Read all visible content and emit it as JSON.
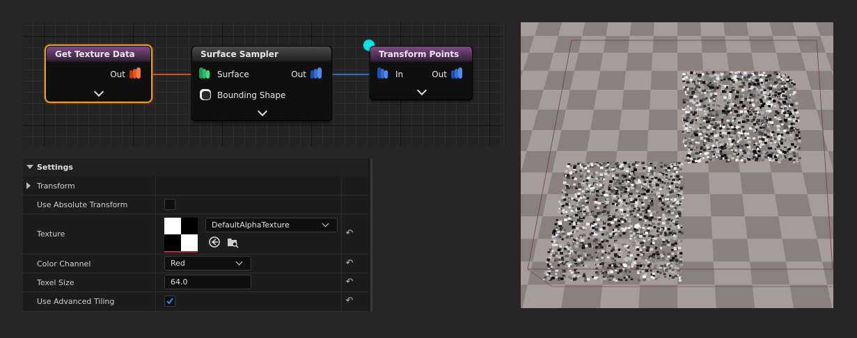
{
  "graph": {
    "nodes": {
      "get_texture_data": {
        "title": "Get Texture Data",
        "out_label": "Out"
      },
      "surface_sampler": {
        "title": "Surface Sampler",
        "surface_label": "Surface",
        "bounding_label": "Bounding Shape",
        "out_label": "Out"
      },
      "transform_points": {
        "title": "Transform Points",
        "in_label": "In",
        "out_label": "Out"
      }
    },
    "colors": {
      "orange_wire": "#d9531e",
      "blue_wire": "#2f6fd6",
      "selection": "#f39c12",
      "reroute_dot": "#00e5e5"
    }
  },
  "settings": {
    "section_title": "Settings",
    "rows": {
      "transform": {
        "label": "Transform"
      },
      "use_absolute_transform": {
        "label": "Use Absolute Transform",
        "checked": false
      },
      "texture": {
        "label": "Texture",
        "value": "DefaultAlphaTexture"
      },
      "color_channel": {
        "label": "Color Channel",
        "value": "Red"
      },
      "texel_size": {
        "label": "Texel Size",
        "value": "64.0"
      },
      "use_advanced_tiling": {
        "label": "Use Advanced Tiling",
        "checked": true
      }
    }
  },
  "icons": [
    "collapse-arrow-icon",
    "expand-arrow-icon",
    "chevron-down-icon",
    "reset-icon",
    "browse-icon",
    "find-in-browser-icon",
    "checkmark-icon",
    "pin-icon",
    "bounding-shape-icon"
  ]
}
